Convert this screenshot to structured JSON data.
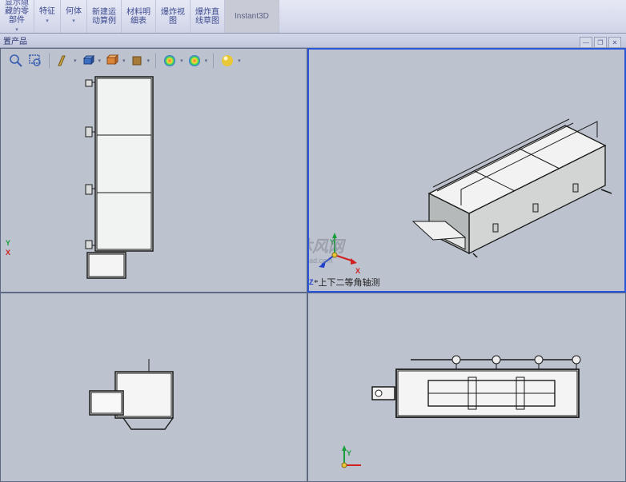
{
  "ribbon": {
    "show_hide_parts": "显示隐\n藏的零\n部件",
    "features": "特征",
    "geometry": "何体",
    "new_motion": "新建运\n动算例",
    "bom": "材料明\n细表",
    "exploded_view": "爆炸视\n图",
    "exploded_sketch": "爆炸直\n线草图",
    "instant3d": "Instant3D"
  },
  "sub_tab": "置产品",
  "view_label": "*上下二等角轴测",
  "watermark": {
    "text": "沐风网",
    "url": "www.mfcad.com"
  },
  "axes": {
    "x": "X",
    "y": "Y",
    "z": "Z"
  }
}
